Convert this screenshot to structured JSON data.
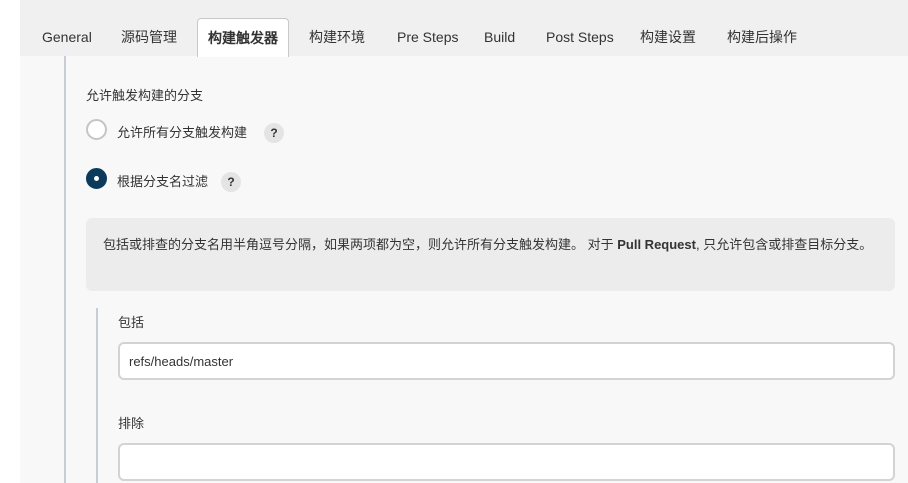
{
  "tabs": [
    {
      "label": "General"
    },
    {
      "label": "源码管理"
    },
    {
      "label": "构建触发器",
      "active": true
    },
    {
      "label": "构建环境"
    },
    {
      "label": "Pre Steps"
    },
    {
      "label": "Build"
    },
    {
      "label": "Post Steps"
    },
    {
      "label": "构建设置"
    },
    {
      "label": "构建后操作"
    }
  ],
  "branch_section": {
    "title": "允许触发构建的分支",
    "options": [
      {
        "label": "允许所有分支触发构建",
        "checked": false,
        "help": "?"
      },
      {
        "label": "根据分支名过滤",
        "checked": true,
        "help": "?"
      }
    ],
    "info": {
      "text_before": "包括或排查的分支名用半角逗号分隔，如果两项都为空，则允许所有分支触发构建。 对于 ",
      "bold": "Pull Request",
      "text_after": ", 只允许包含或排查目标分支。"
    },
    "include": {
      "label": "包括",
      "value": "refs/heads/master"
    },
    "exclude": {
      "label": "排除",
      "value": ""
    }
  }
}
